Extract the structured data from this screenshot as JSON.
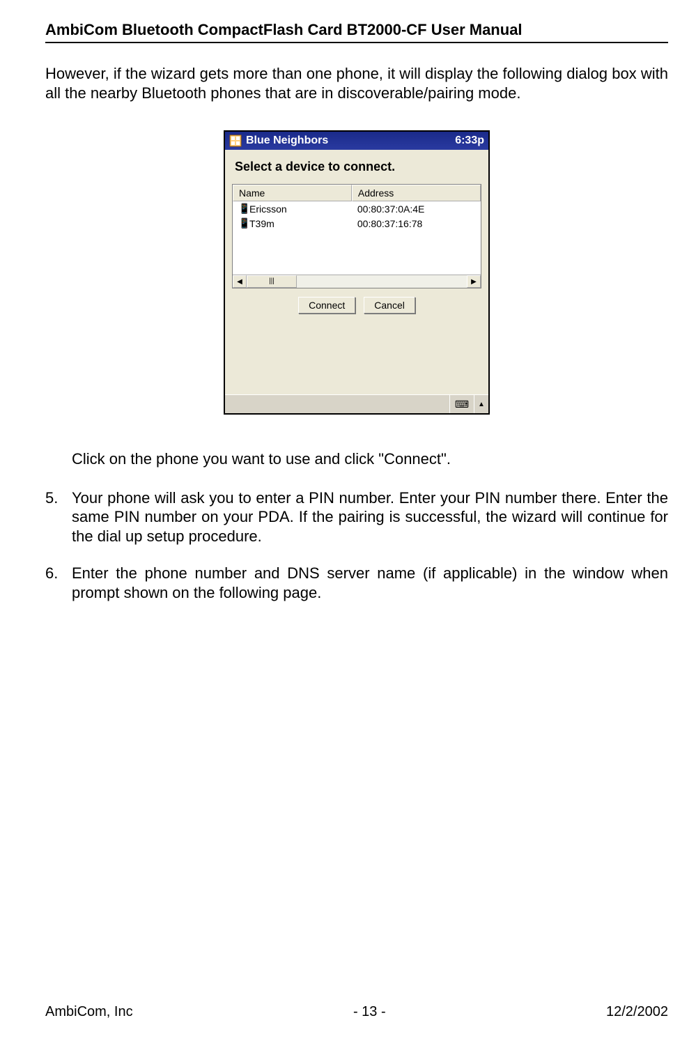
{
  "header": {
    "title": "AmbiCom Bluetooth CompactFlash Card BT2000-CF User Manual"
  },
  "intro_para": "However, if the wizard gets more than one phone, it will display the following dialog box with all the nearby Bluetooth phones that are in discoverable/pairing mode.",
  "screenshot": {
    "titlebar": {
      "app_name": "Blue Neighbors",
      "time": "6:33p"
    },
    "instruction": "Select a device to connect.",
    "columns": {
      "name": "Name",
      "address": "Address"
    },
    "rows": [
      {
        "icon": "📱",
        "name": "Ericsson",
        "address": "00:80:37:0A:4E"
      },
      {
        "icon": "📱",
        "name": "T39m",
        "address": "00:80:37:16:78"
      }
    ],
    "scroll_thumb_glyph": "|||",
    "scroll_left": "◀",
    "scroll_right": "▶",
    "buttons": {
      "connect": "Connect",
      "cancel": "Cancel"
    },
    "taskbar": {
      "sip_icon": "⌨",
      "up_icon": "▲"
    }
  },
  "click_para": "Click on the phone you want to use and click \"Connect\".",
  "steps": [
    {
      "num": "5.",
      "text": "Your phone will ask you to enter a PIN number. Enter your PIN number there. Enter the same PIN number on your PDA. If the pairing is successful, the wizard will continue for the dial up setup procedure."
    },
    {
      "num": "6.",
      "text": "Enter the phone number and DNS server name (if applicable) in the window when prompt shown on the following page."
    }
  ],
  "footer": {
    "left": "AmbiCom, Inc",
    "center": "- 13 -",
    "right": "12/2/2002"
  }
}
